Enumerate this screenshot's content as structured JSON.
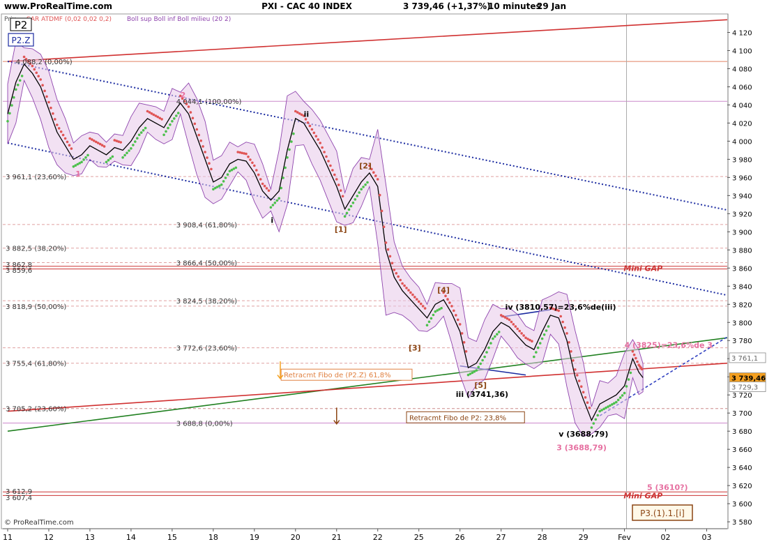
{
  "header": {
    "site": "www.ProRealTime.com",
    "title": "PXI - CAC 40 INDEX",
    "price_change": "3 739,46 (+1,37%)",
    "timeframe": "10 minutes",
    "date": "29 Jan"
  },
  "legend": {
    "prix": "Prix",
    "sar": "SAR ATDMF (0,02 0,02 0,2)",
    "boll": "Boll sup Boll inf Boll milieu (20 2)",
    "sar_color": "#e05555",
    "boll_color": "#8e44ad"
  },
  "boxes": {
    "p2": "P2",
    "p2z": "P2.Z",
    "p3": "P3.(1).1.[i]"
  },
  "footer": "© ProRealTime.com",
  "chart_data": {
    "type": "line",
    "title": "PXI - CAC 40 INDEX",
    "ylim": [
      3572,
      4140
    ],
    "y_ticks": [
      4120,
      4100,
      4080,
      4060,
      4040,
      4020,
      4000,
      3980,
      3960,
      3940,
      3920,
      3900,
      3880,
      3860,
      3840,
      3820,
      3800,
      3780,
      3760,
      3740,
      3720,
      3700,
      3680,
      3660,
      3640,
      3620,
      3600,
      3580
    ],
    "y_tick_labels": [
      "4 120",
      "4 100",
      "4 080",
      "4 060",
      "4 040",
      "4 020",
      "4 000",
      "3 980",
      "3 960",
      "3 940",
      "3 920",
      "3 900",
      "3 880",
      "3 860",
      "3 840",
      "3 820",
      "3 800",
      "3 780",
      "3 760",
      "3 740",
      "3 720",
      "3 700",
      "3 680",
      "3 660",
      "3 640",
      "3 620",
      "3 600",
      "3 580"
    ],
    "x_tick_labels": [
      "11",
      "12",
      "13",
      "14",
      "15",
      "18",
      "19",
      "20",
      "21",
      "22",
      "25",
      "26",
      "27",
      "28",
      "29",
      "Fev",
      "02",
      "03"
    ],
    "xlim": [
      0,
      17.5
    ],
    "price_path": [
      [
        0,
        4030
      ],
      [
        0.2,
        4065
      ],
      [
        0.4,
        4085
      ],
      [
        0.6,
        4075
      ],
      [
        0.8,
        4060
      ],
      [
        1.0,
        4035
      ],
      [
        1.2,
        4010
      ],
      [
        1.4,
        3995
      ],
      [
        1.6,
        3980
      ],
      [
        1.8,
        3985
      ],
      [
        2.0,
        3995
      ],
      [
        2.2,
        3990
      ],
      [
        2.4,
        3985
      ],
      [
        2.6,
        3993
      ],
      [
        2.8,
        3990
      ],
      [
        3.0,
        4000
      ],
      [
        3.2,
        4015
      ],
      [
        3.4,
        4025
      ],
      [
        3.6,
        4020
      ],
      [
        3.8,
        4015
      ],
      [
        4.0,
        4030
      ],
      [
        4.2,
        4042
      ],
      [
        4.4,
        4030
      ],
      [
        4.6,
        4005
      ],
      [
        4.8,
        3980
      ],
      [
        5.0,
        3955
      ],
      [
        5.2,
        3960
      ],
      [
        5.4,
        3975
      ],
      [
        5.6,
        3980
      ],
      [
        5.8,
        3978
      ],
      [
        6.0,
        3965
      ],
      [
        6.2,
        3945
      ],
      [
        6.4,
        3935
      ],
      [
        6.6,
        3945
      ],
      [
        6.8,
        3990
      ],
      [
        7.0,
        4025
      ],
      [
        7.2,
        4020
      ],
      [
        7.4,
        4005
      ],
      [
        7.6,
        3990
      ],
      [
        7.8,
        3970
      ],
      [
        8.0,
        3950
      ],
      [
        8.2,
        3925
      ],
      [
        8.4,
        3940
      ],
      [
        8.6,
        3955
      ],
      [
        8.8,
        3965
      ],
      [
        9.0,
        3950
      ],
      [
        9.2,
        3880
      ],
      [
        9.4,
        3850
      ],
      [
        9.6,
        3835
      ],
      [
        9.8,
        3825
      ],
      [
        10.0,
        3815
      ],
      [
        10.2,
        3805
      ],
      [
        10.4,
        3820
      ],
      [
        10.6,
        3825
      ],
      [
        10.8,
        3810
      ],
      [
        11.0,
        3790
      ],
      [
        11.2,
        3750
      ],
      [
        11.4,
        3755
      ],
      [
        11.6,
        3770
      ],
      [
        11.8,
        3790
      ],
      [
        12.0,
        3800
      ],
      [
        12.2,
        3795
      ],
      [
        12.4,
        3785
      ],
      [
        12.6,
        3775
      ],
      [
        12.8,
        3770
      ],
      [
        13.0,
        3790
      ],
      [
        13.2,
        3808
      ],
      [
        13.4,
        3805
      ],
      [
        13.6,
        3780
      ],
      [
        13.8,
        3740
      ],
      [
        14.0,
        3715
      ],
      [
        14.2,
        3692
      ],
      [
        14.4,
        3710
      ],
      [
        14.6,
        3715
      ],
      [
        14.8,
        3720
      ],
      [
        15.0,
        3730
      ],
      [
        15.2,
        3760
      ],
      [
        15.35,
        3745
      ],
      [
        15.45,
        3739
      ]
    ],
    "series": [
      {
        "name": "SAR ATDMF (0,02 0,02 0,2)",
        "color": "#e05555"
      },
      {
        "name": "Boll sup Boll inf Boll milieu (20 2)",
        "color": "#8e44ad"
      }
    ],
    "horizontal_levels": [
      {
        "value": 4088,
        "color": "#e08060",
        "style": "solid"
      },
      {
        "value": 4044,
        "color": "#cc88cc",
        "style": "solid"
      },
      {
        "value": 3961,
        "color": "#e0a0a0",
        "style": "dashed"
      },
      {
        "value": 3908,
        "color": "#e0a0a0",
        "style": "dashed"
      },
      {
        "value": 3882,
        "color": "#e0a0a0",
        "style": "dashed"
      },
      {
        "value": 3866,
        "color": "#e0a0a0",
        "style": "dashed"
      },
      {
        "value": 3862,
        "color": "#cc3333",
        "style": "solid"
      },
      {
        "value": 3859,
        "color": "#cc3333",
        "style": "solid"
      },
      {
        "value": 3824,
        "color": "#e0a0a0",
        "style": "dashed"
      },
      {
        "value": 3818,
        "color": "#e0a0a0",
        "style": "dashed"
      },
      {
        "value": 3772,
        "color": "#e0a0a0",
        "style": "dashed"
      },
      {
        "value": 3755,
        "color": "#e0a0a0",
        "style": "dashed"
      },
      {
        "value": 3705,
        "color": "#cc8888",
        "style": "dashed"
      },
      {
        "value": 3689,
        "color": "#cc88cc",
        "style": "solid"
      },
      {
        "value": 3613,
        "color": "#cc3333",
        "style": "solid"
      },
      {
        "value": 3609,
        "color": "#cc3333",
        "style": "solid"
      }
    ],
    "trend_lines": [
      {
        "from": [
          0,
          4088
        ],
        "to": [
          17.5,
          4134
        ],
        "color": "#d03030",
        "style": "solid"
      },
      {
        "from": [
          0,
          4088
        ],
        "to": [
          17.5,
          3924
        ],
        "color": "#1a2aa0",
        "style": "dotted"
      },
      {
        "from": [
          0,
          3998
        ],
        "to": [
          17.5,
          3830
        ],
        "color": "#1a2aa0",
        "style": "dotted"
      },
      {
        "from": [
          0,
          3680
        ],
        "to": [
          17.5,
          3783
        ],
        "color": "#208020",
        "style": "solid"
      },
      {
        "from": [
          0,
          3702
        ],
        "to": [
          17.5,
          3755
        ],
        "color": "#d03030",
        "style": "solid"
      },
      {
        "from": [
          14.4,
          3697
        ],
        "to": [
          17.5,
          3784
        ],
        "color": "#3040c0",
        "style": "dashed"
      },
      {
        "from": [
          11.0,
          3752
        ],
        "to": [
          12.6,
          3742
        ],
        "color": "#1a2aa0",
        "style": "solid"
      },
      {
        "from": [
          12.0,
          3806
        ],
        "to": [
          13.2,
          3814
        ],
        "color": "#1a2aa0",
        "style": "solid"
      }
    ],
    "vertical_marker": {
      "x": 15.05,
      "color": "#aaaaaa"
    },
    "level_labels": [
      {
        "text": "4 088,2 (0,00%)",
        "x": 0.25,
        "value": 4088,
        "color": "#333333"
      },
      {
        "text": "4 044,1 (100,00%)",
        "x": 4.15,
        "value": 4044,
        "color": "#333333"
      },
      {
        "text": "3 961,1 (23,60%)",
        "x": 0.0,
        "value": 3961,
        "color": "#333333"
      },
      {
        "text": "3 908,4 (61,80%)",
        "x": 4.15,
        "value": 3908,
        "color": "#333333"
      },
      {
        "text": "3 882,5 (38,20%)",
        "x": 0.0,
        "value": 3882,
        "color": "#333333"
      },
      {
        "text": "3 866,4 (50,00%)",
        "x": 4.15,
        "value": 3866,
        "color": "#333333"
      },
      {
        "text": "3 862,8",
        "x": 0.0,
        "value": 3864,
        "color": "#333333"
      },
      {
        "text": "3 859,6",
        "x": 0.0,
        "value": 3858,
        "color": "#333333"
      },
      {
        "text": "3 824,5 (38,20%)",
        "x": 4.15,
        "value": 3824,
        "color": "#333333"
      },
      {
        "text": "3 818,9 (50,00%)",
        "x": 0.0,
        "value": 3818,
        "color": "#333333"
      },
      {
        "text": "3 772,6 (23,60%)",
        "x": 4.15,
        "value": 3772,
        "color": "#333333"
      },
      {
        "text": "3 755,4 (61,80%)",
        "x": 0.0,
        "value": 3755,
        "color": "#333333"
      },
      {
        "text": "3 705,2 (23,60%)",
        "x": 0.0,
        "value": 3705,
        "color": "#333333"
      },
      {
        "text": "3 688,8 (0,00%)",
        "x": 4.15,
        "value": 3689,
        "color": "#333333"
      },
      {
        "text": "3 612,9",
        "x": 0.0,
        "value": 3614,
        "color": "#333333"
      },
      {
        "text": "3 607,4",
        "x": 0.0,
        "value": 3607,
        "color": "#333333"
      }
    ],
    "wave_labels": [
      {
        "text": "2",
        "x": 4.2,
        "value": 4051,
        "color": "#e66fa0"
      },
      {
        "text": "1",
        "x": 1.65,
        "value": 3964,
        "color": "#e66fa0"
      },
      {
        "text": "ii",
        "x": 7.2,
        "value": 4030,
        "color": "#000000"
      },
      {
        "text": "i",
        "x": 6.4,
        "value": 3913,
        "color": "#000000"
      },
      {
        "text": "[2]",
        "x": 8.55,
        "value": 3973,
        "color": "#8b4513"
      },
      {
        "text": "[1]",
        "x": 7.95,
        "value": 3903,
        "color": "#8b4513"
      },
      {
        "text": "[4]",
        "x": 10.45,
        "value": 3836,
        "color": "#8b4513"
      },
      {
        "text": "[3]",
        "x": 9.75,
        "value": 3772,
        "color": "#8b4513"
      },
      {
        "text": "[5]",
        "x": 11.35,
        "value": 3731,
        "color": "#8b4513"
      },
      {
        "text": "iv (3810,57)=23,6%de(iii)",
        "x": 12.1,
        "value": 3817,
        "color": "#000000"
      },
      {
        "text": "iii (3741,36)",
        "x": 10.9,
        "value": 3721,
        "color": "#000000"
      },
      {
        "text": "v (3688,79)",
        "x": 13.4,
        "value": 3677,
        "color": "#000000"
      },
      {
        "text": "3 (3688,79)",
        "x": 13.35,
        "value": 3662,
        "color": "#e66fa0"
      },
      {
        "text": "4 (3825)=23,6%de 3",
        "x": 15.0,
        "value": 3775,
        "color": "#e66fa0"
      },
      {
        "text": "5 (3610?)",
        "x": 15.55,
        "value": 3618,
        "color": "#e66fa0"
      },
      {
        "text": "Mini GAP",
        "x": 14.98,
        "value": 3860,
        "color": "#cc3333"
      },
      {
        "text": "Mini GAP",
        "x": 14.98,
        "value": 3609,
        "color": "#cc3333"
      }
    ],
    "annotation_boxes": [
      {
        "text": "Retracmt Fibo de (P2.Z) 61,8%",
        "x": 6.65,
        "value": 3740,
        "color": "#e08040"
      },
      {
        "text": "Retracmt Fibo de P2: 23,8%",
        "x": 9.7,
        "value": 3693,
        "color": "#8b4513"
      }
    ],
    "price_tags": [
      {
        "text": "3 761,1",
        "value": 3761,
        "color": "#666666",
        "bg": "#ffffff"
      },
      {
        "text": "3 739,46",
        "value": 3739,
        "color": "#000000",
        "bg": "#f4a020"
      },
      {
        "text": "3 729,3",
        "value": 3729,
        "color": "#666666",
        "bg": "#ffffff"
      }
    ]
  }
}
